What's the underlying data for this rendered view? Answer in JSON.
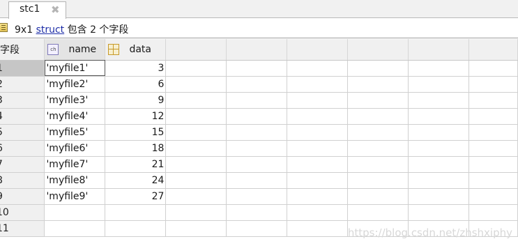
{
  "tab": {
    "title": "stc1",
    "close_glyph": "✖"
  },
  "info": {
    "dims": "9x1",
    "class_link": "struct",
    "suffix": "包含 2 个字段"
  },
  "table": {
    "corner_label": "字段",
    "columns": [
      {
        "label": "name",
        "icon": "char-column-icon"
      },
      {
        "label": "data",
        "icon": "double-column-icon"
      }
    ],
    "rows": [
      {
        "index": "1",
        "name": "'myfile1'",
        "data": "3"
      },
      {
        "index": "2",
        "name": "'myfile2'",
        "data": "6"
      },
      {
        "index": "3",
        "name": "'myfile3'",
        "data": "9"
      },
      {
        "index": "4",
        "name": "'myfile4'",
        "data": "12"
      },
      {
        "index": "5",
        "name": "'myfile5'",
        "data": "15"
      },
      {
        "index": "6",
        "name": "'myfile6'",
        "data": "18"
      },
      {
        "index": "7",
        "name": "'myfile7'",
        "data": "21"
      },
      {
        "index": "8",
        "name": "'myfile8'",
        "data": "24"
      },
      {
        "index": "9",
        "name": "'myfile9'",
        "data": "27"
      },
      {
        "index": "10",
        "name": "",
        "data": ""
      },
      {
        "index": "11",
        "name": "",
        "data": ""
      }
    ]
  },
  "watermark": "https://blog.csdn.net/zhshxiphy"
}
